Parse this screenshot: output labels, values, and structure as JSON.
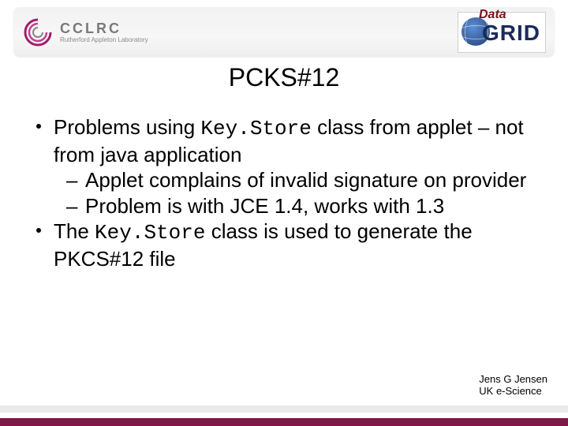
{
  "header": {
    "left_logo_main": "CCLRC",
    "left_logo_sub": "Rutherford Appleton Laboratory",
    "right_logo_top": "Data",
    "right_logo_main": "GRID"
  },
  "title": "PCKS#12",
  "bullets": {
    "b1a_pre": "Problems using ",
    "b1a_code": "Key.Store",
    "b1a_post": " class from applet – not from java application",
    "b1a_sub1": "Applet complains of invalid signature on provider",
    "b1a_sub2": "Problem is with JCE 1.4, works with 1.3",
    "b1b_pre": "The ",
    "b1b_code": "Key.Store",
    "b1b_post": " class is used to generate the PKCS#12 file"
  },
  "footer": {
    "author": "Jens G Jensen",
    "org": "UK e-Science"
  }
}
